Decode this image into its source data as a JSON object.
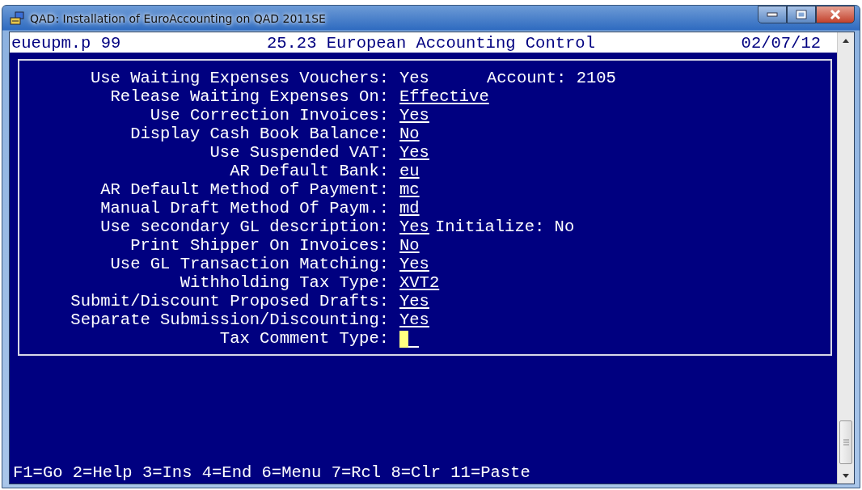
{
  "window": {
    "title": "QAD: Installation of EuroAccounting on QAD 2011SE"
  },
  "header": {
    "program": "eueupm.p 99",
    "title": "25.23 European Accounting Control",
    "date": "02/07/12"
  },
  "rows": [
    {
      "label": "Use Waiting Expenses Vouchers:",
      "value": "Yes",
      "kind": "display",
      "extra": "Account: 2105"
    },
    {
      "label": "Release Waiting Expenses On:",
      "value": "Effective",
      "kind": "field"
    },
    {
      "label": "Use Correction Invoices:",
      "value": "Yes",
      "kind": "field"
    },
    {
      "label": "Display Cash Book Balance:",
      "value": "No",
      "kind": "field"
    },
    {
      "label": "Use Suspended VAT:",
      "value": "Yes",
      "kind": "field"
    },
    {
      "label": "AR Default Bank:",
      "value": "eu",
      "kind": "field"
    },
    {
      "label": "AR Default Method of Payment:",
      "value": "mc",
      "kind": "field"
    },
    {
      "label": "Manual Draft Method Of Paym.:",
      "value": "md",
      "kind": "field"
    },
    {
      "label": "Use secondary GL description:",
      "value": "Yes",
      "kind": "field",
      "extra": "Initialize: No"
    },
    {
      "label": "Print Shipper On Invoices:",
      "value": "No",
      "kind": "field"
    },
    {
      "label": "Use GL Transaction Matching:",
      "value": "Yes",
      "kind": "field"
    },
    {
      "label": "Withholding Tax Type:",
      "value": "XVT2",
      "kind": "field"
    },
    {
      "label": "Submit/Discount Proposed Drafts:",
      "value": "Yes",
      "kind": "field"
    },
    {
      "label": "Separate Submission/Discounting:",
      "value": "Yes",
      "kind": "field"
    },
    {
      "label": "Tax Comment Type:",
      "kind": "cursor"
    }
  ],
  "footer": "F1=Go 2=Help 3=Ins 4=End 6=Menu 7=Rcl 8=Clr 11=Paste"
}
